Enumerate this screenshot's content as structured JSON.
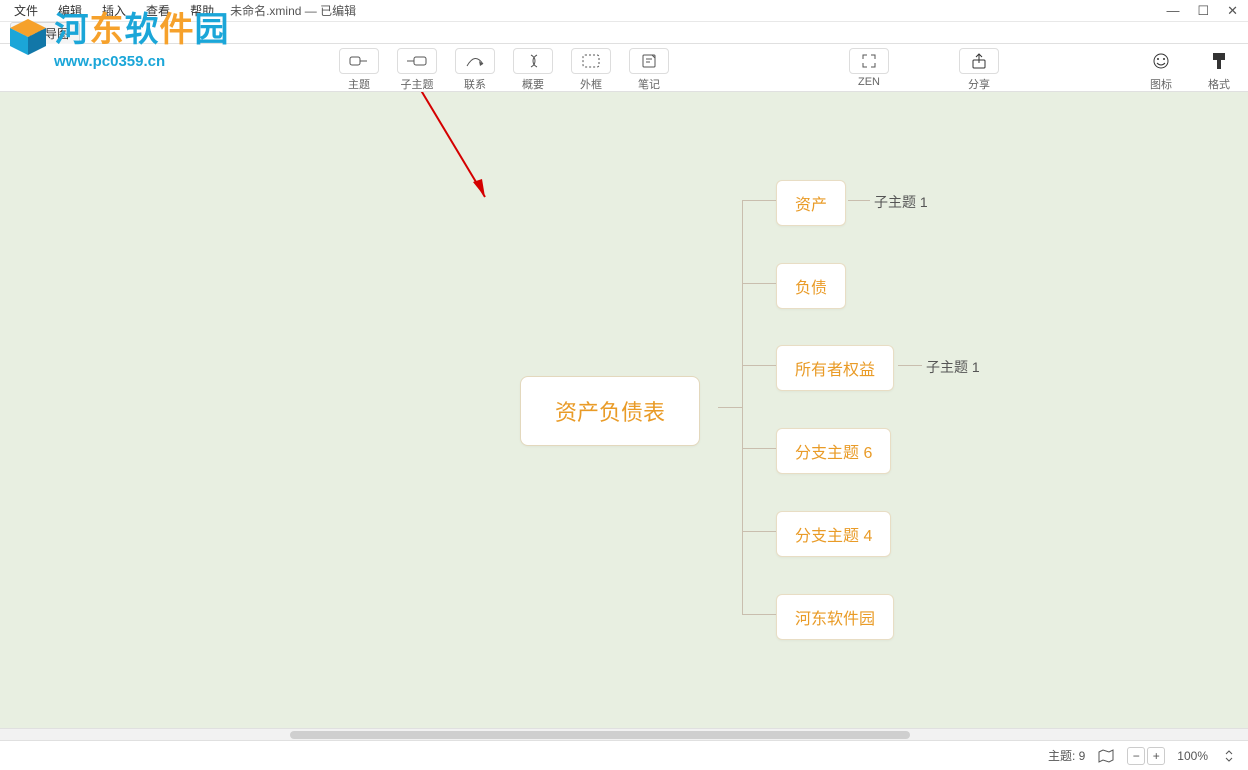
{
  "menu": {
    "items": [
      "文件",
      "编辑",
      "插入",
      "查看",
      "帮助"
    ],
    "title": "未命名.xmind — 已编辑"
  },
  "win": {
    "min": "—",
    "max": "☐",
    "close": "✕"
  },
  "tab": {
    "label": "思维导图"
  },
  "toolbar": {
    "topic": "主题",
    "subtopic": "子主题",
    "relation": "联系",
    "summary": "概要",
    "boundary": "外框",
    "note": "笔记",
    "zen": "ZEN",
    "share": "分享",
    "marker": "图标",
    "format": "格式"
  },
  "mindmap": {
    "central": "资产负债表",
    "branches": [
      {
        "label": "资产",
        "sub": "子主题 1"
      },
      {
        "label": "负债"
      },
      {
        "label": "所有者权益",
        "sub": "子主题 1"
      },
      {
        "label": "分支主题 6"
      },
      {
        "label": "分支主题 4"
      },
      {
        "label": "河东软件园"
      }
    ]
  },
  "status": {
    "topics_label": "主题: 9",
    "zoom": "100%"
  },
  "watermark": {
    "line1": "河东软件园",
    "line2": "www.pc0359.cn"
  }
}
